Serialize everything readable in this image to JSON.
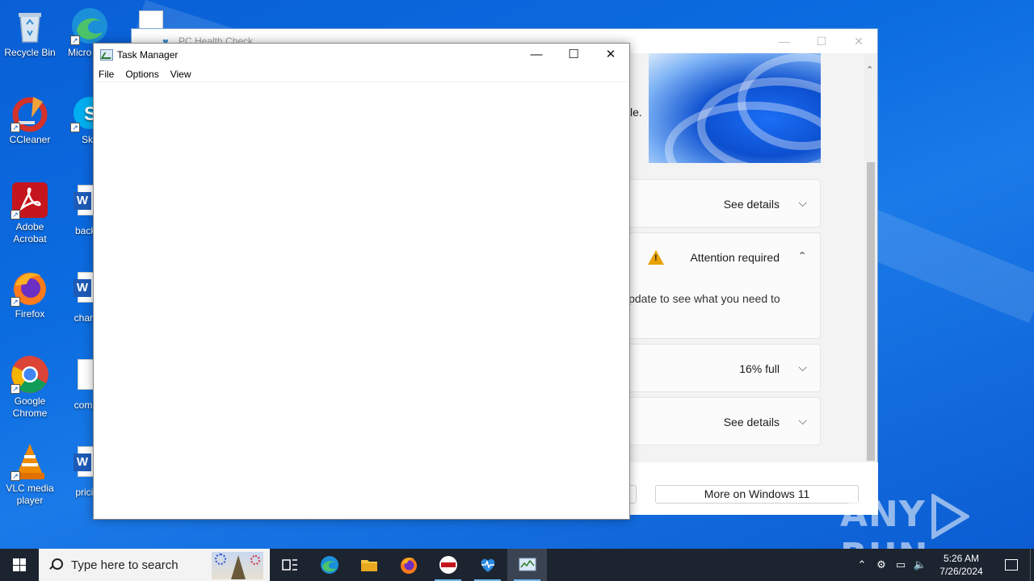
{
  "desktop": {
    "icons": [
      {
        "label": "Recycle Bin"
      },
      {
        "label": "Micro Edg"
      },
      {
        "label": "CCleaner"
      },
      {
        "label": "Sky"
      },
      {
        "label": "Adobe Acrobat"
      },
      {
        "label": "backgr"
      },
      {
        "label": "Firefox"
      },
      {
        "label": "chance"
      },
      {
        "label": "Google Chrome"
      },
      {
        "label": "comple"
      },
      {
        "label": "VLC media player"
      },
      {
        "label": "pricing"
      }
    ]
  },
  "pc_health_check": {
    "title": "PC Health Check",
    "partial_text": "le.",
    "cards": [
      {
        "label": "See details",
        "chevron": "down"
      },
      {
        "label": "Attention required",
        "chevron": "up",
        "body": "Update to see what you need to"
      },
      {
        "label": "16% full",
        "chevron": "down"
      },
      {
        "label": "See details",
        "chevron": "down"
      }
    ],
    "more_button": "More on Windows 11"
  },
  "task_manager": {
    "title": "Task Manager",
    "menu": [
      "File",
      "Options",
      "View"
    ]
  },
  "taskbar": {
    "search_placeholder": "Type here to search",
    "clock_time": "5:26 AM",
    "clock_date": "7/26/2024"
  },
  "watermark": {
    "left": "ANY",
    "right": "RUN"
  }
}
